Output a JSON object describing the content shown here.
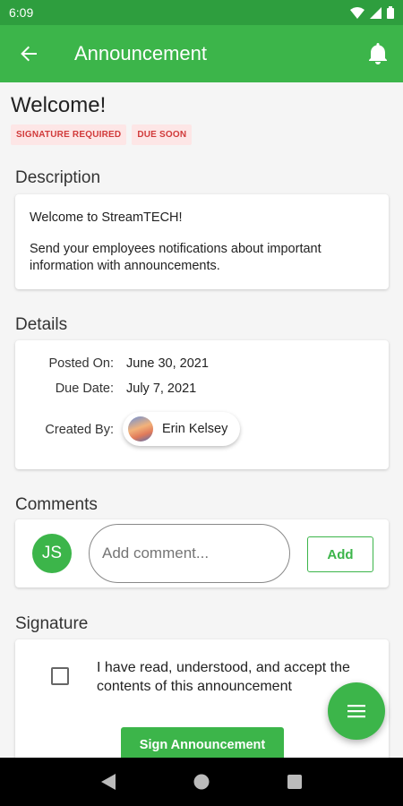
{
  "status_bar": {
    "time": "6:09"
  },
  "app_bar": {
    "title": "Announcement"
  },
  "announcement": {
    "title": "Welcome!",
    "badges": [
      "SIGNATURE REQUIRED",
      "DUE SOON"
    ],
    "badge_color": "#d13a3a"
  },
  "description": {
    "heading": "Description",
    "line1": "Welcome to StreamTECH!",
    "line2": "Send your employees notifications about important information with announcements."
  },
  "details": {
    "heading": "Details",
    "posted_label": "Posted On:",
    "posted_value": "June 30, 2021",
    "due_label": "Due Date:",
    "due_value": "July 7, 2021",
    "created_label": "Created By:",
    "creator_name": "Erin Kelsey"
  },
  "comments": {
    "heading": "Comments",
    "avatar_initials": "JS",
    "input_placeholder": "Add comment...",
    "add_label": "Add"
  },
  "signature": {
    "heading": "Signature",
    "acknowledgement": "I have read, understood, and accept the contents of this announcement",
    "button_label": "Sign Announcement"
  },
  "colors": {
    "primary": "#3cb54a",
    "status_bar": "#2e9e3e"
  }
}
